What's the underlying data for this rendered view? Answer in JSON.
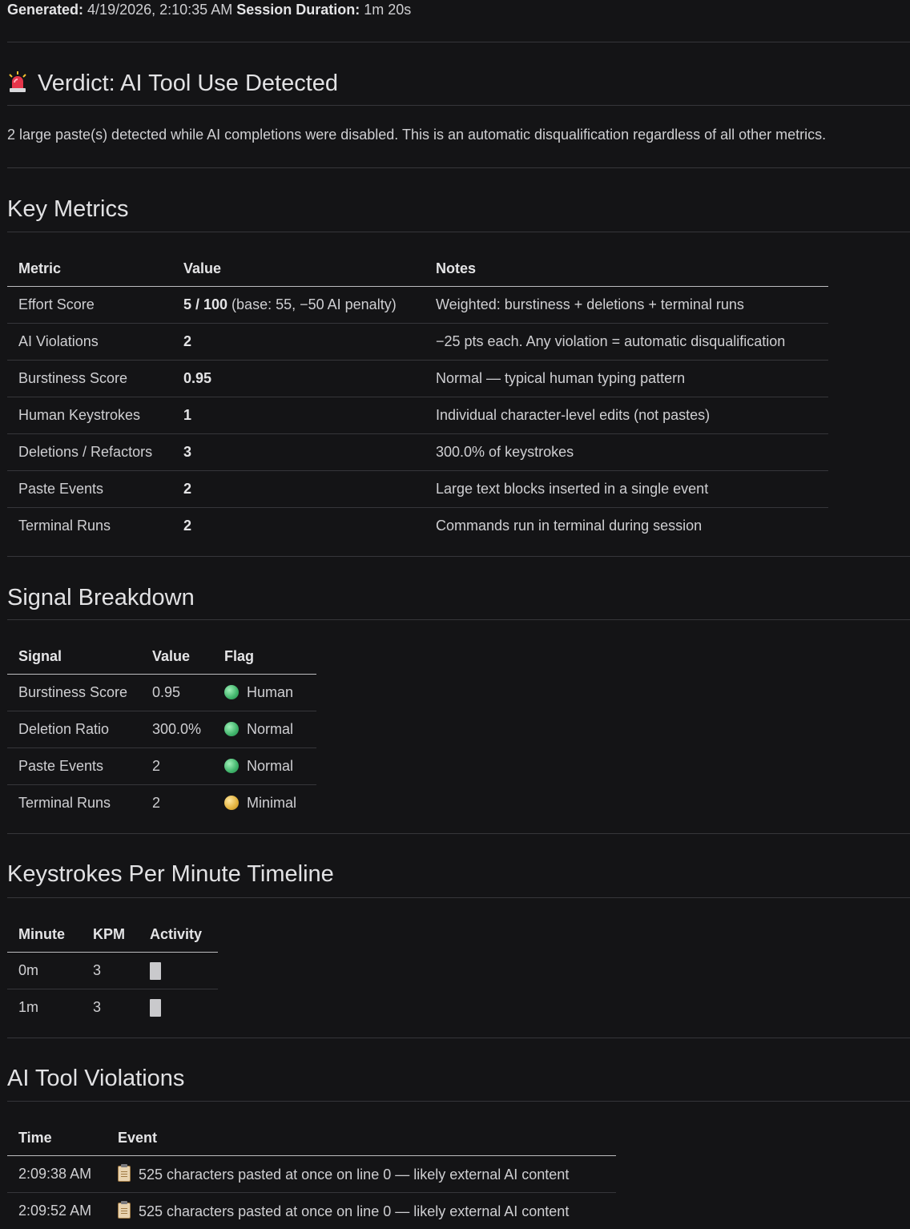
{
  "meta": {
    "generated_label": "Generated:",
    "generated_value": "4/19/2026, 2:10:35 AM",
    "duration_label": "Session Duration:",
    "duration_value": "1m 20s"
  },
  "verdict": {
    "title": "Verdict: AI Tool Use Detected",
    "icon": "siren-icon",
    "text": "2 large paste(s) detected while AI completions were disabled. This is an automatic disqualification regardless of all other metrics."
  },
  "key_metrics": {
    "title": "Key Metrics",
    "headers": [
      "Metric",
      "Value",
      "Notes"
    ],
    "rows": [
      {
        "metric": "Effort Score",
        "value_bold": "5 / 100",
        "value_extra": " (base: 55, −50 AI penalty)",
        "notes": "Weighted: burstiness + deletions + terminal runs"
      },
      {
        "metric": "AI Violations",
        "value_bold": "2",
        "value_extra": "",
        "notes": "−25 pts each. Any violation = automatic disqualification"
      },
      {
        "metric": "Burstiness Score",
        "value_bold": "0.95",
        "value_extra": "",
        "notes": "Normal — typical human typing pattern"
      },
      {
        "metric": "Human Keystrokes",
        "value_bold": "1",
        "value_extra": "",
        "notes": "Individual character-level edits (not pastes)"
      },
      {
        "metric": "Deletions / Refactors",
        "value_bold": "3",
        "value_extra": "",
        "notes": "300.0% of keystrokes"
      },
      {
        "metric": "Paste Events",
        "value_bold": "2",
        "value_extra": "",
        "notes": "Large text blocks inserted in a single event"
      },
      {
        "metric": "Terminal Runs",
        "value_bold": "2",
        "value_extra": "",
        "notes": "Commands run in terminal during session"
      }
    ]
  },
  "signal_breakdown": {
    "title": "Signal Breakdown",
    "headers": [
      "Signal",
      "Value",
      "Flag"
    ],
    "rows": [
      {
        "signal": "Burstiness Score",
        "value": "0.95",
        "flag": "Human",
        "flag_color": "#3fb36a"
      },
      {
        "signal": "Deletion Ratio",
        "value": "300.0%",
        "flag": "Normal",
        "flag_color": "#3fb36a"
      },
      {
        "signal": "Paste Events",
        "value": "2",
        "flag": "Normal",
        "flag_color": "#3fb36a"
      },
      {
        "signal": "Terminal Runs",
        "value": "2",
        "flag": "Minimal",
        "flag_color": "#e2b13c"
      }
    ]
  },
  "kpm_timeline": {
    "title": "Keystrokes Per Minute Timeline",
    "headers": [
      "Minute",
      "KPM",
      "Activity"
    ],
    "rows": [
      {
        "minute": "0m",
        "kpm": "3"
      },
      {
        "minute": "1m",
        "kpm": "3"
      }
    ]
  },
  "violations": {
    "title": "AI Tool Violations",
    "headers": [
      "Time",
      "Event"
    ],
    "rows": [
      {
        "time": "2:09:38 AM",
        "icon": "clipboard-icon",
        "event": "525 characters pasted at once on line 0 — likely external AI content"
      },
      {
        "time": "2:09:52 AM",
        "icon": "clipboard-icon",
        "event": "525 characters pasted at once on line 0 — likely external AI content"
      }
    ]
  }
}
